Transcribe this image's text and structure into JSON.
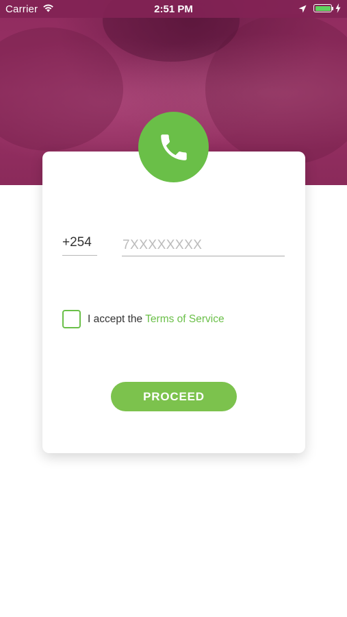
{
  "status_bar": {
    "carrier": "Carrier",
    "time": "2:51 PM",
    "wifi_icon": "wifi-icon",
    "location_icon": "location-arrow-icon",
    "battery_icon": "battery-full-icon",
    "charging_icon": "charging-bolt-icon"
  },
  "header": {
    "background": "photo-two-people",
    "phone_icon": "phone-handset-icon"
  },
  "form": {
    "country_code": "+254",
    "phone_placeholder": "7XXXXXXXX",
    "phone_value": "",
    "accept_checked": false,
    "terms_prefix": "I accept the",
    "terms_link": "Terms of Service",
    "proceed_label": "PROCEED"
  },
  "colors": {
    "accent_green": "#6abf48",
    "button_green": "#7cc24d",
    "header_magenta": "#8f2b5e"
  }
}
